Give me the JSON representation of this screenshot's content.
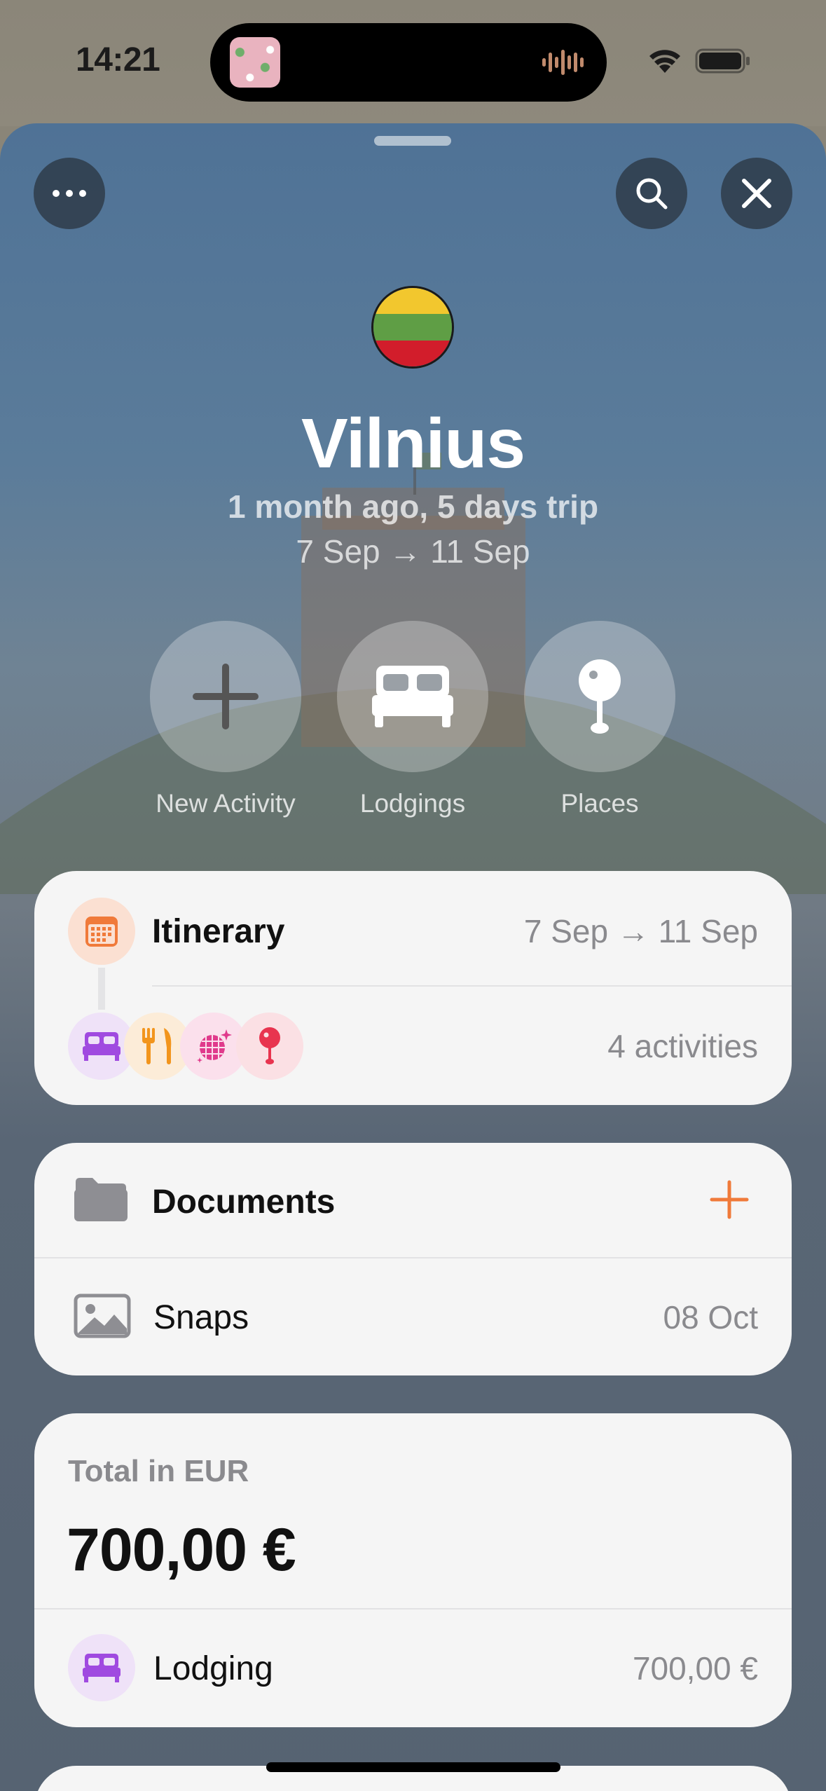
{
  "status_bar": {
    "time": "14:21"
  },
  "trip": {
    "city": "Vilnius",
    "subtitle": "1 month ago, 5 days trip",
    "dates": "7 Sep → 11 Sep"
  },
  "header_buttons": {
    "more": "more-icon",
    "search": "search-icon",
    "close": "close-icon"
  },
  "actions": [
    {
      "label": "New Activity",
      "icon": "plus-icon"
    },
    {
      "label": "Lodgings",
      "icon": "bed-icon"
    },
    {
      "label": "Places",
      "icon": "pin-icon"
    }
  ],
  "itinerary": {
    "title": "Itinerary",
    "dates": "7 Sep → 11 Sep",
    "activities_count": "4 activities",
    "activity_icons": [
      "bed-icon",
      "fork-knife-icon",
      "disco-ball-icon",
      "pin-icon"
    ]
  },
  "documents": {
    "title": "Documents",
    "snaps_label": "Snaps",
    "snaps_date": "08 Oct"
  },
  "expenses": {
    "total_label": "Total in EUR",
    "total_value": "700,00 €",
    "lodging_label": "Lodging",
    "lodging_value": "700,00 €"
  },
  "colors": {
    "accent_orange": "#f07a3a",
    "lodging_purple": "#a04ae0",
    "food_orange": "#f2951c",
    "nightlife_pink": "#e03a8c",
    "place_red": "#e8344f",
    "flag_yellow": "#f2c72e",
    "flag_green": "#5f9e45",
    "flag_red": "#d21d2b"
  }
}
